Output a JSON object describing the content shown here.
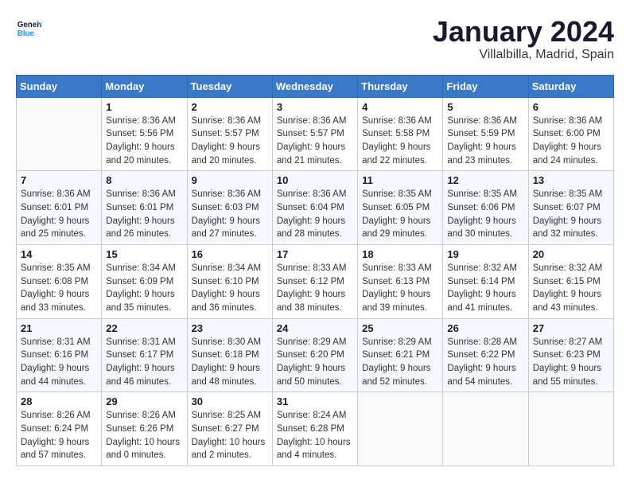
{
  "header": {
    "logo_general": "General",
    "logo_blue": "Blue",
    "month_title": "January 2024",
    "location": "Villalbilla, Madrid, Spain"
  },
  "days_of_week": [
    "Sunday",
    "Monday",
    "Tuesday",
    "Wednesday",
    "Thursday",
    "Friday",
    "Saturday"
  ],
  "weeks": [
    [
      {
        "day": "",
        "info": ""
      },
      {
        "day": "1",
        "info": "Sunrise: 8:36 AM\nSunset: 5:56 PM\nDaylight: 9 hours\nand 20 minutes."
      },
      {
        "day": "2",
        "info": "Sunrise: 8:36 AM\nSunset: 5:57 PM\nDaylight: 9 hours\nand 20 minutes."
      },
      {
        "day": "3",
        "info": "Sunrise: 8:36 AM\nSunset: 5:57 PM\nDaylight: 9 hours\nand 21 minutes."
      },
      {
        "day": "4",
        "info": "Sunrise: 8:36 AM\nSunset: 5:58 PM\nDaylight: 9 hours\nand 22 minutes."
      },
      {
        "day": "5",
        "info": "Sunrise: 8:36 AM\nSunset: 5:59 PM\nDaylight: 9 hours\nand 23 minutes."
      },
      {
        "day": "6",
        "info": "Sunrise: 8:36 AM\nSunset: 6:00 PM\nDaylight: 9 hours\nand 24 minutes."
      }
    ],
    [
      {
        "day": "7",
        "info": ""
      },
      {
        "day": "8",
        "info": "Sunrise: 8:36 AM\nSunset: 6:01 PM\nDaylight: 9 hours\nand 26 minutes."
      },
      {
        "day": "9",
        "info": "Sunrise: 8:36 AM\nSunset: 6:03 PM\nDaylight: 9 hours\nand 27 minutes."
      },
      {
        "day": "10",
        "info": "Sunrise: 8:36 AM\nSunset: 6:04 PM\nDaylight: 9 hours\nand 28 minutes."
      },
      {
        "day": "11",
        "info": "Sunrise: 8:35 AM\nSunset: 6:05 PM\nDaylight: 9 hours\nand 29 minutes."
      },
      {
        "day": "12",
        "info": "Sunrise: 8:35 AM\nSunset: 6:06 PM\nDaylight: 9 hours\nand 30 minutes."
      },
      {
        "day": "13",
        "info": "Sunrise: 8:35 AM\nSunset: 6:07 PM\nDaylight: 9 hours\nand 32 minutes."
      }
    ],
    [
      {
        "day": "14",
        "info": "Sunrise: 8:35 AM\nSunset: 6:08 PM\nDaylight: 9 hours\nand 33 minutes."
      },
      {
        "day": "15",
        "info": "Sunrise: 8:34 AM\nSunset: 6:09 PM\nDaylight: 9 hours\nand 35 minutes."
      },
      {
        "day": "16",
        "info": "Sunrise: 8:34 AM\nSunset: 6:10 PM\nDaylight: 9 hours\nand 36 minutes."
      },
      {
        "day": "17",
        "info": "Sunrise: 8:33 AM\nSunset: 6:12 PM\nDaylight: 9 hours\nand 38 minutes."
      },
      {
        "day": "18",
        "info": "Sunrise: 8:33 AM\nSunset: 6:13 PM\nDaylight: 9 hours\nand 39 minutes."
      },
      {
        "day": "19",
        "info": "Sunrise: 8:32 AM\nSunset: 6:14 PM\nDaylight: 9 hours\nand 41 minutes."
      },
      {
        "day": "20",
        "info": "Sunrise: 8:32 AM\nSunset: 6:15 PM\nDaylight: 9 hours\nand 43 minutes."
      }
    ],
    [
      {
        "day": "21",
        "info": "Sunrise: 8:31 AM\nSunset: 6:16 PM\nDaylight: 9 hours\nand 44 minutes."
      },
      {
        "day": "22",
        "info": "Sunrise: 8:31 AM\nSunset: 6:17 PM\nDaylight: 9 hours\nand 46 minutes."
      },
      {
        "day": "23",
        "info": "Sunrise: 8:30 AM\nSunset: 6:18 PM\nDaylight: 9 hours\nand 48 minutes."
      },
      {
        "day": "24",
        "info": "Sunrise: 8:29 AM\nSunset: 6:20 PM\nDaylight: 9 hours\nand 50 minutes."
      },
      {
        "day": "25",
        "info": "Sunrise: 8:29 AM\nSunset: 6:21 PM\nDaylight: 9 hours\nand 52 minutes."
      },
      {
        "day": "26",
        "info": "Sunrise: 8:28 AM\nSunset: 6:22 PM\nDaylight: 9 hours\nand 54 minutes."
      },
      {
        "day": "27",
        "info": "Sunrise: 8:27 AM\nSunset: 6:23 PM\nDaylight: 9 hours\nand 55 minutes."
      }
    ],
    [
      {
        "day": "28",
        "info": "Sunrise: 8:26 AM\nSunset: 6:24 PM\nDaylight: 9 hours\nand 57 minutes."
      },
      {
        "day": "29",
        "info": "Sunrise: 8:26 AM\nSunset: 6:26 PM\nDaylight: 10 hours\nand 0 minutes."
      },
      {
        "day": "30",
        "info": "Sunrise: 8:25 AM\nSunset: 6:27 PM\nDaylight: 10 hours\nand 2 minutes."
      },
      {
        "day": "31",
        "info": "Sunrise: 8:24 AM\nSunset: 6:28 PM\nDaylight: 10 hours\nand 4 minutes."
      },
      {
        "day": "",
        "info": ""
      },
      {
        "day": "",
        "info": ""
      },
      {
        "day": "",
        "info": ""
      }
    ]
  ]
}
